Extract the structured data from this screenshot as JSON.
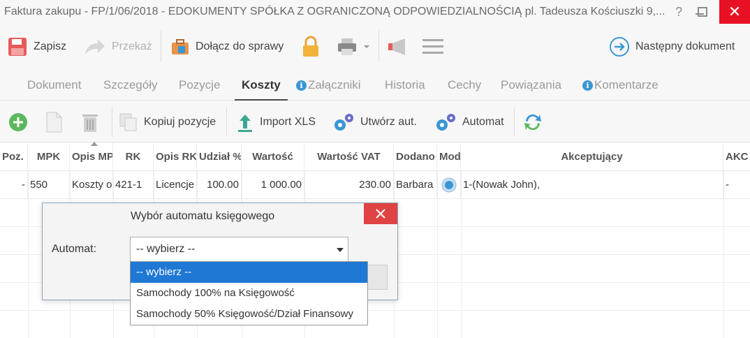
{
  "window": {
    "title": "Faktura zakupu - FP/1/06/2018 - EDOKUMENTY SPÓŁKA Z OGRANICZONĄ ODPOWIEDZIALNOŚCIĄ pl. Tadeusza Kościuszki 9,...",
    "help": "?",
    "close": "✕"
  },
  "toolbar": {
    "save": "Zapisz",
    "forward": "Przekaż",
    "attach_case": "Dołącz do sprawy",
    "next_document": "Następny dokument"
  },
  "tabs": [
    {
      "label": "Dokument"
    },
    {
      "label": "Szczegóły"
    },
    {
      "label": "Pozycje"
    },
    {
      "label": "Koszty"
    },
    {
      "label": "Załączniki"
    },
    {
      "label": "Historia"
    },
    {
      "label": "Cechy"
    },
    {
      "label": "Powiązania"
    },
    {
      "label": "Komentarze"
    }
  ],
  "subtoolbar": {
    "copy_items": "Kopiuj pozycje",
    "import_xls": "Import XLS",
    "create_auto": "Utwórz aut.",
    "automat": "Automat"
  },
  "grid": {
    "headers": [
      "Poz.",
      "MPK",
      "Opis MP",
      "RK",
      "Opis RK",
      "Udział %",
      "Wartość",
      "Wartość VAT",
      "Dodano",
      "Mod",
      "Akceptujący",
      "AKC"
    ],
    "rows": [
      {
        "poz": "-",
        "mpk": "550",
        "opis_mpk": "Koszty o",
        "rk": "421-1",
        "opis_rk": "Licencje",
        "udzial": "100.00",
        "wartosc": "1 000.00",
        "wartosc_vat": "230.00",
        "dodano": "Barbara",
        "akceptujacy": "1-(Nowak John),",
        "akc": "-"
      }
    ]
  },
  "modal": {
    "title": "Wybór automatu księgowego",
    "label": "Automat:",
    "selected": "-- wybierz --",
    "options": [
      "-- wybierz --",
      "Samochody 100% na Księgowość",
      "Samochody 50% Księgowość/Dział Finansowy"
    ]
  },
  "colors": {
    "close_red": "#e81123",
    "modal_close": "#e04343",
    "selected_option": "#1e78d4",
    "info_blue": "#3a97d4",
    "add_green": "#5cb85c",
    "arrow_blue": "#3a97d4"
  }
}
